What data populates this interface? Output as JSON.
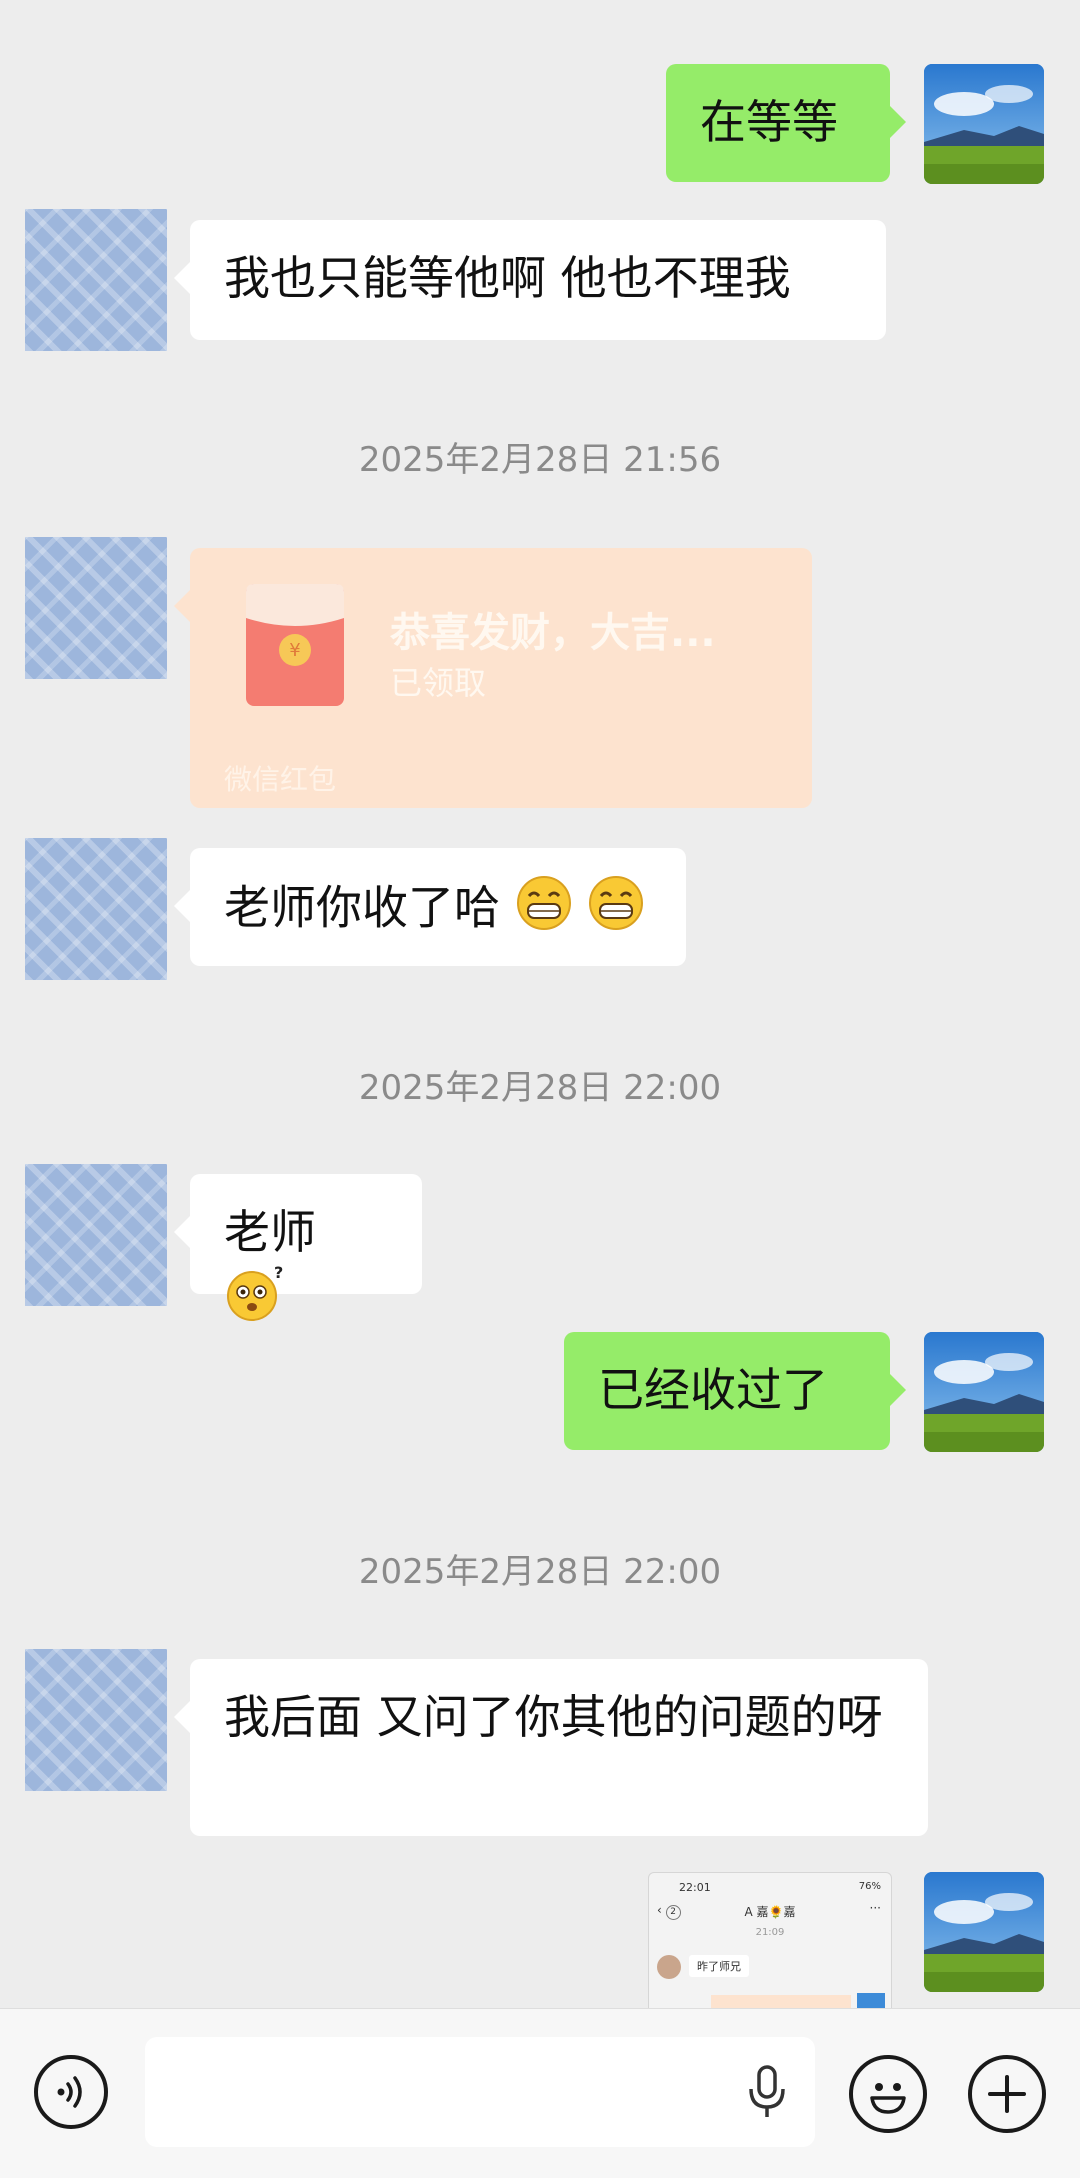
{
  "messages": [
    {
      "side": "right",
      "text": "在等等"
    },
    {
      "side": "left",
      "text": "我也只能等他啊 他也不理我"
    },
    {
      "timestamp": "2025年2月28日 21:56"
    },
    {
      "red_packet": {
        "title": "恭喜发财，大吉...",
        "status": "已领取",
        "label": "微信红包"
      }
    },
    {
      "side": "left",
      "text": "老师你收了哈",
      "emojis": [
        "grin-emoji",
        "grin-emoji"
      ]
    },
    {
      "timestamp": "2025年2月28日 22:00"
    },
    {
      "side": "left",
      "text": "老师",
      "emojis": [
        "confused-emoji"
      ]
    },
    {
      "side": "right",
      "text": "已经收过了"
    },
    {
      "timestamp": "2025年2月28日 22:00"
    },
    {
      "side": "left",
      "text": "我后面 又问了你其他的问题的呀"
    },
    {
      "side": "right",
      "image": "screenshot-thumbnail"
    }
  ],
  "thumbnail": {
    "status_time": "22:01",
    "battery": "76%",
    "back_count": "2",
    "chat_title": "A 嘉🌻嘉",
    "time": "21:09",
    "message": "昨了师兄"
  },
  "bottom_bar": {
    "icons": [
      "voice-toggle-icon",
      "microphone-icon",
      "emoji-icon",
      "plus-icon"
    ],
    "input_value": ""
  },
  "colors": {
    "background": "#ededed",
    "sent_bubble": "#95ec69",
    "received_bubble": "#ffffff",
    "red_packet_opened": "#fde3cf",
    "timestamp": "#8a8a8a"
  }
}
